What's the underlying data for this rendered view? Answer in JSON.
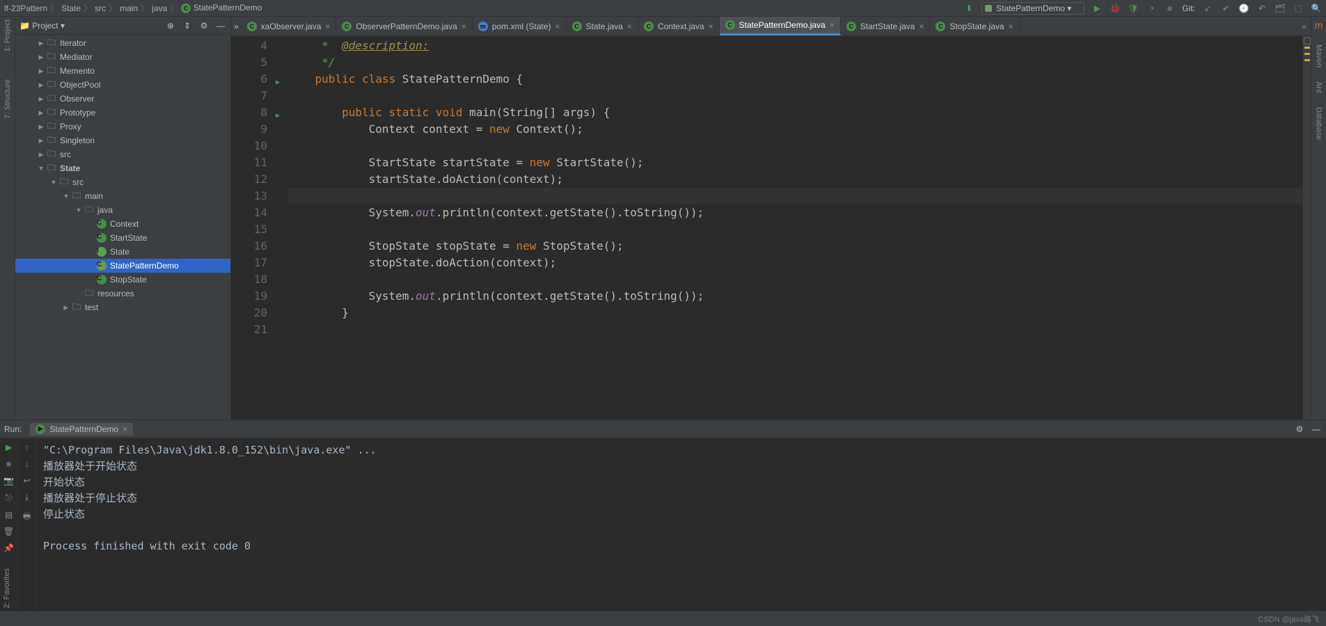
{
  "breadcrumbs": [
    "lf-23Pattern",
    "State",
    "src",
    "main",
    "java",
    "StatePatternDemo"
  ],
  "run_config": "StatePatternDemo",
  "git_label": "Git:",
  "project_label": "Project",
  "left_tools": [
    "1: Project",
    "7: Structure"
  ],
  "right_tools": [
    "Maven",
    "Ant",
    "Database"
  ],
  "favorites_label": "2: Favorites",
  "tabs": [
    {
      "label": "xaObserver.java",
      "kind": "java",
      "active": false,
      "scroll": "»"
    },
    {
      "label": "ObserverPatternDemo.java",
      "kind": "java-run",
      "active": false
    },
    {
      "label": "pom.xml (State)",
      "kind": "pom",
      "active": false
    },
    {
      "label": "State.java",
      "kind": "java",
      "active": false
    },
    {
      "label": "Context.java",
      "kind": "java",
      "active": false
    },
    {
      "label": "StatePatternDemo.java",
      "kind": "java-run",
      "active": true
    },
    {
      "label": "StartState.java",
      "kind": "java",
      "active": false
    },
    {
      "label": "StopState.java",
      "kind": "java",
      "active": false
    }
  ],
  "tree": [
    {
      "indent": 1,
      "label": "Iterator",
      "type": "folder",
      "arrow": "▶"
    },
    {
      "indent": 1,
      "label": "Mediator",
      "type": "folder",
      "arrow": "▶"
    },
    {
      "indent": 1,
      "label": "Memento",
      "type": "folder",
      "arrow": "▶"
    },
    {
      "indent": 1,
      "label": "ObjectPool",
      "type": "folder",
      "arrow": "▶"
    },
    {
      "indent": 1,
      "label": "Observer",
      "type": "folder",
      "arrow": "▶"
    },
    {
      "indent": 1,
      "label": "Prototype",
      "type": "folder",
      "arrow": "▶"
    },
    {
      "indent": 1,
      "label": "Proxy",
      "type": "folder",
      "arrow": "▶"
    },
    {
      "indent": 1,
      "label": "Singleton",
      "type": "folder",
      "arrow": "▶"
    },
    {
      "indent": 1,
      "label": "src",
      "type": "folder",
      "arrow": "▶"
    },
    {
      "indent": 1,
      "label": "State",
      "type": "folder",
      "arrow": "▼",
      "bold": true
    },
    {
      "indent": 2,
      "label": "src",
      "type": "folder",
      "arrow": "▼"
    },
    {
      "indent": 3,
      "label": "main",
      "type": "folder",
      "arrow": "▼"
    },
    {
      "indent": 4,
      "label": "java",
      "type": "folder-src",
      "arrow": "▼"
    },
    {
      "indent": 5,
      "label": "Context",
      "type": "class",
      "arrow": ""
    },
    {
      "indent": 5,
      "label": "StartState",
      "type": "class",
      "arrow": ""
    },
    {
      "indent": 5,
      "label": "State",
      "type": "iface",
      "arrow": ""
    },
    {
      "indent": 5,
      "label": "StatePatternDemo",
      "type": "class-run",
      "arrow": "",
      "selected": true
    },
    {
      "indent": 5,
      "label": "StopState",
      "type": "class",
      "arrow": ""
    },
    {
      "indent": 4,
      "label": "resources",
      "type": "folder-res",
      "arrow": ""
    },
    {
      "indent": 3,
      "label": "test",
      "type": "folder",
      "arrow": "▶"
    }
  ],
  "line_numbers": [
    4,
    5,
    6,
    7,
    8,
    9,
    10,
    11,
    12,
    13,
    14,
    15,
    16,
    17,
    18,
    19,
    20,
    21
  ],
  "run_markers": {
    "6": true,
    "8": true
  },
  "code_lines": [
    {
      "html": "     <span class='com'>*  <span class='ann'>@description:</span></span>"
    },
    {
      "html": "     <span class='com'>*/</span>"
    },
    {
      "html": "    <span class='kw'>public class</span> StatePatternDemo {"
    },
    {
      "html": ""
    },
    {
      "html": "        <span class='kw'>public static void</span> main(String[] args) {"
    },
    {
      "html": "            Context context = <span class='kw'>new</span> Context();"
    },
    {
      "html": ""
    },
    {
      "html": "            StartState startState = <span class='kw'>new</span> StartState();"
    },
    {
      "html": "            startState.doAction(context);"
    },
    {
      "html": "",
      "hl": true,
      "caret": true
    },
    {
      "html": "            System.<span class='fld'>out</span>.println(context.getState().toString());"
    },
    {
      "html": ""
    },
    {
      "html": "            StopState stopState = <span class='kw'>new</span> StopState();"
    },
    {
      "html": "            stopState.doAction(context);"
    },
    {
      "html": ""
    },
    {
      "html": "            System.<span class='fld'>out</span>.println(context.getState().toString());"
    },
    {
      "html": "        }"
    },
    {
      "html": ""
    }
  ],
  "run_label": "Run:",
  "run_tab": "StatePatternDemo",
  "console": [
    "\"C:\\Program Files\\Java\\jdk1.8.0_152\\bin\\java.exe\" ...",
    "播放器处于开始状态",
    "开始状态",
    "播放器处于停止状态",
    "停止状态",
    "",
    "Process finished with exit code 0"
  ],
  "watermark": "CSDN @java路飞"
}
